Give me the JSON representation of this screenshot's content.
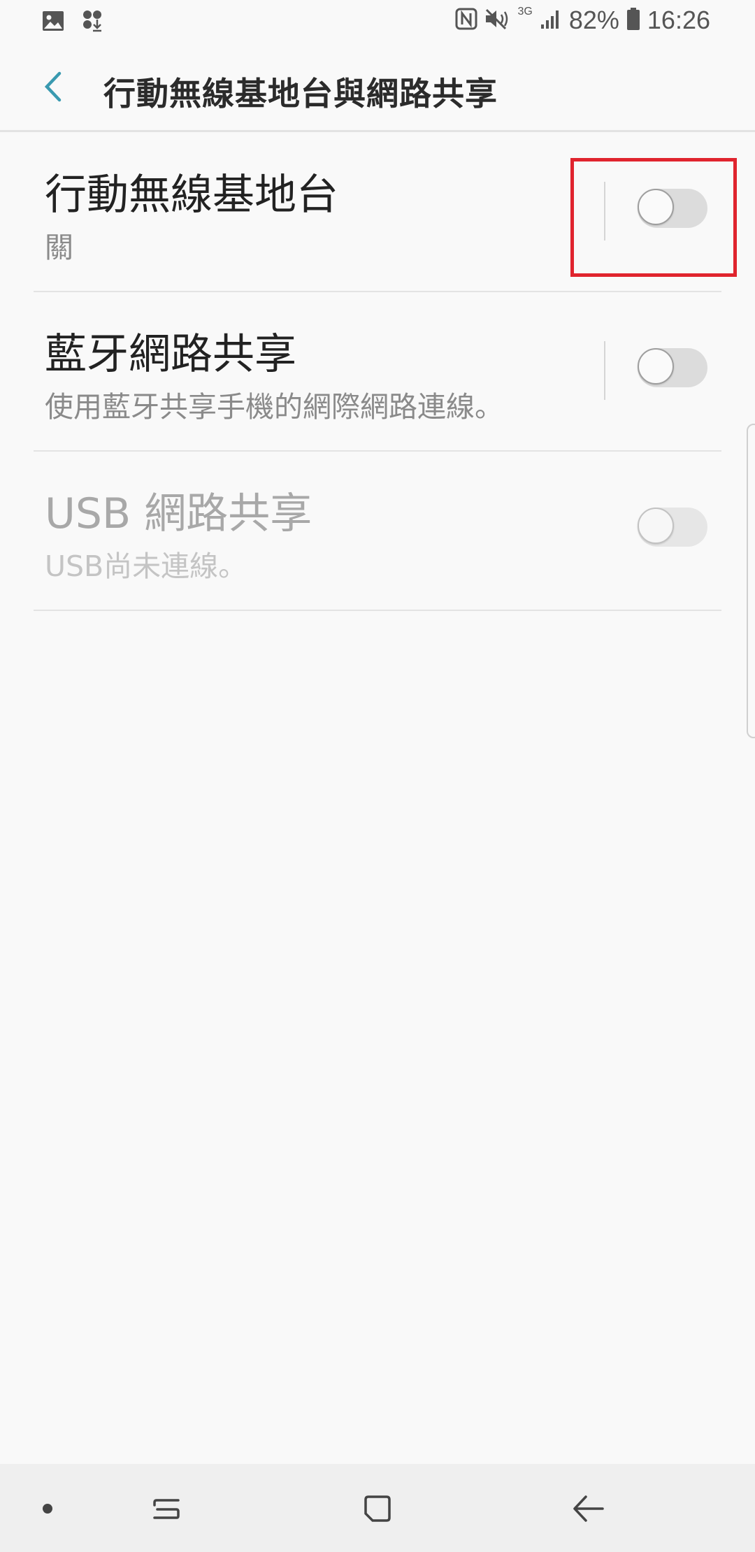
{
  "status_bar": {
    "battery": "82%",
    "time": "16:26",
    "network_type": "3G",
    "icons": [
      "gallery-icon",
      "download-icon",
      "nfc-icon",
      "mute-icon",
      "signal-icon",
      "battery-icon"
    ]
  },
  "header": {
    "title": "行動無線基地台與網路共享",
    "back_icon": "chevron-left-icon",
    "accent_color": "#3a9ab0"
  },
  "settings": [
    {
      "title": "行動無線基地台",
      "subtitle": "關",
      "enabled": true,
      "on": false,
      "has_divider": true,
      "highlighted": true
    },
    {
      "title": "藍牙網路共享",
      "subtitle": "使用藍牙共享手機的網際網路連線。",
      "enabled": true,
      "on": false,
      "has_divider": true,
      "highlighted": false
    },
    {
      "title": "USB 網路共享",
      "subtitle": "USB尚未連線。",
      "enabled": false,
      "on": false,
      "has_divider": false,
      "highlighted": false
    }
  ],
  "highlight_color": "#e0242e",
  "nav_bar": {
    "buttons": [
      "dot-icon",
      "recents-icon",
      "home-icon",
      "back-icon"
    ]
  }
}
